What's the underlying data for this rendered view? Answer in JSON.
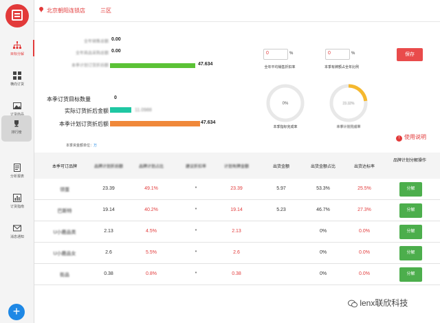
{
  "header": {
    "store": "北京朝阳连锁店",
    "district": "三区"
  },
  "sidebar": {
    "items": [
      {
        "label": "目标分解",
        "icon": "org-chart-icon",
        "active": true
      },
      {
        "label": "横向订货",
        "icon": "grid-icon"
      },
      {
        "label": "订货商品",
        "icon": "image-icon"
      },
      {
        "label": "排行榜",
        "icon": "trophy-icon",
        "selected": true
      },
      {
        "label": "分析报表",
        "icon": "report-icon"
      },
      {
        "label": "订货指南",
        "icon": "chart-icon"
      },
      {
        "label": "消息通知",
        "icon": "mail-icon"
      }
    ]
  },
  "summary": {
    "year_sales_label": "全年销售总额",
    "year_sales_value": "0.00",
    "year_goods_label": "全年商品采购总额",
    "year_goods_value": "0.00",
    "season_plan_label": "本季计划订货折后额",
    "season_plan_value": "47.634",
    "season_plan_fill": 0.68
  },
  "order": {
    "order_label": "本季订货目标数量",
    "order_value": "0",
    "actual_label": "实际订货折后金额",
    "actual_value": "11.0988",
    "actual_fill": 0.17,
    "plan_label": "本季计划订货折后额",
    "plan_value": "47.634",
    "plan_fill": 0.72
  },
  "inputs": {
    "annual_rate": {
      "value": "0",
      "unit": "%",
      "caption": "全年平均销售折扣率"
    },
    "brand_ratio": {
      "value": "0",
      "unit": "%",
      "caption": "本季有牌额占全年比例"
    }
  },
  "circles": [
    {
      "label": "0%",
      "caption": "本季指标完成率",
      "fraction": 0
    },
    {
      "label": "23.32%",
      "caption": "本季计划完成率",
      "fraction": 0.23
    }
  ],
  "save_label": "保存",
  "help_label": "使用说明",
  "note": {
    "text": "本季资金额单位：",
    "unit": "万"
  },
  "table": {
    "headers": [
      "本季可订品牌",
      "品牌计划折后额",
      "品牌计划占比",
      "建议折扣率",
      "计划有牌金额",
      "出货金额",
      "出货金额占比",
      "出货达标率",
      "品牌计划分解操作"
    ],
    "rows": [
      {
        "brand": "领蛋",
        "plan": "23.39",
        "ratio": "49.1%",
        "rate": "*",
        "amount": "23.39",
        "ship": "5.97",
        "ship_ratio": "53.3%",
        "reach": "25.5%",
        "action": "分解"
      },
      {
        "brand": "巴斯特",
        "plan": "19.14",
        "ratio": "40.2%",
        "rate": "*",
        "amount": "19.14",
        "ship": "5.23",
        "ship_ratio": "46.7%",
        "reach": "27.3%",
        "action": "分解"
      },
      {
        "brand": "U小鹿品类",
        "plan": "2.13",
        "ratio": "4.5%",
        "rate": "*",
        "amount": "2.13",
        "ship": "",
        "ship_ratio": "0%",
        "reach": "0.0%",
        "action": "分解"
      },
      {
        "brand": "U小鹿品女",
        "plan": "2.6",
        "ratio": "5.5%",
        "rate": "*",
        "amount": "2.6",
        "ship": "",
        "ship_ratio": "0%",
        "reach": "0.0%",
        "action": "分解"
      },
      {
        "brand": "街品",
        "plan": "0.38",
        "ratio": "0.8%",
        "rate": "*",
        "amount": "0.38",
        "ship": "",
        "ship_ratio": "0%",
        "reach": "0.0%",
        "action": "分解"
      }
    ]
  },
  "watermark": "lenx联欣科技",
  "colors": {
    "accent": "#e23a3a",
    "green": "#5bc236",
    "teal": "#1fc7a3",
    "orange": "#f0883a",
    "action": "#4cae4c",
    "donut": "#f5b82e"
  }
}
